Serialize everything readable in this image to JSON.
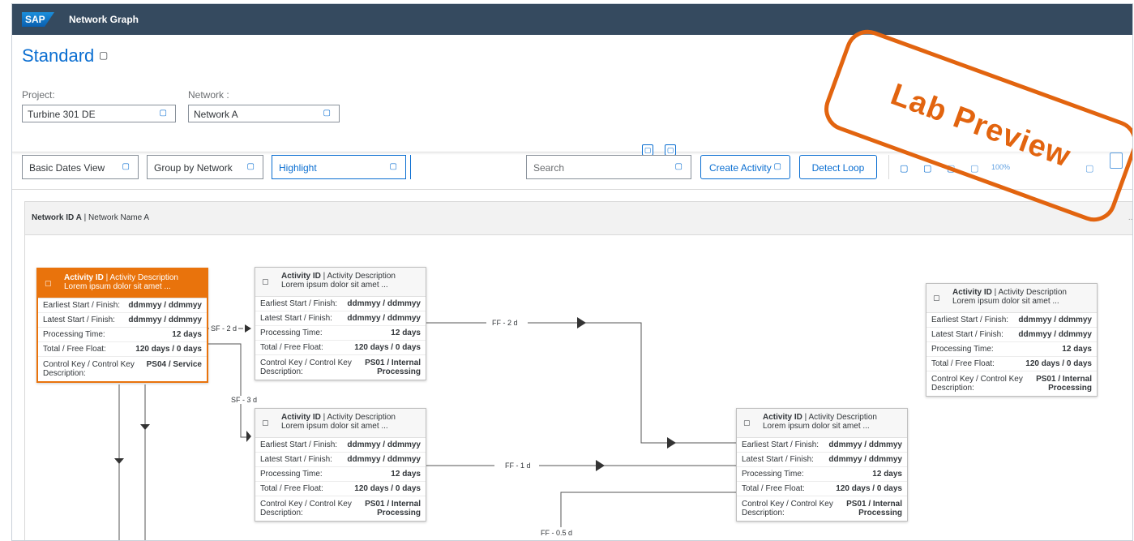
{
  "shell": {
    "logo": "SAP",
    "title": "Network Graph"
  },
  "page": {
    "title": "Standard",
    "title_icon": "▢"
  },
  "filters": {
    "project_label": "Project:",
    "project_value": "Turbine 301 DE",
    "network_label": "Network :",
    "network_value": "Network A",
    "value_help_icon": "▢"
  },
  "toolbar": {
    "view": "Basic Dates View",
    "group": "Group by Network",
    "highlight": "Highlight",
    "search_placeholder": "Search",
    "create_activity": "Create Activity",
    "detect_loop": "Detect Loop",
    "zoom": "100%",
    "dropdown_icon": "▢",
    "mini_icon": "▢"
  },
  "group": {
    "id": "Network ID A",
    "separator": " | ",
    "name": "Network Name A",
    "more": "...."
  },
  "node_labels": {
    "activity_id": "Activity ID",
    "activity_desc": " | Activity Description",
    "lorem": "Lorem ipsum dolor sit amet ...",
    "earliest": "Earliest Start / Finish:",
    "latest": "Latest Start / Finish:",
    "processing": "Processing Time:",
    "float": "Total / Free Float:",
    "control_1": "Control Key / Control Key",
    "control_2": "Description:",
    "dates": "ddmmyy / ddmmyy",
    "days": "12 days",
    "float_val": "120 days / 0 days",
    "ctrl_service": "PS04 / Service",
    "ctrl_internal_1": "PS01 / Internal",
    "ctrl_internal_2": "Processing"
  },
  "edges": {
    "sf2": "SF - 2 d",
    "sf3": "SF - 3 d",
    "ff2": "FF - 2 d",
    "ff1": "FF - 1 d",
    "ff05": "FF - 0.5 d"
  },
  "watermark": "Lab Preview",
  "colors": {
    "shell": "#354a5f",
    "accent": "#0a6ed1",
    "selected": "#e9730c",
    "stamp": "#e2640f"
  }
}
